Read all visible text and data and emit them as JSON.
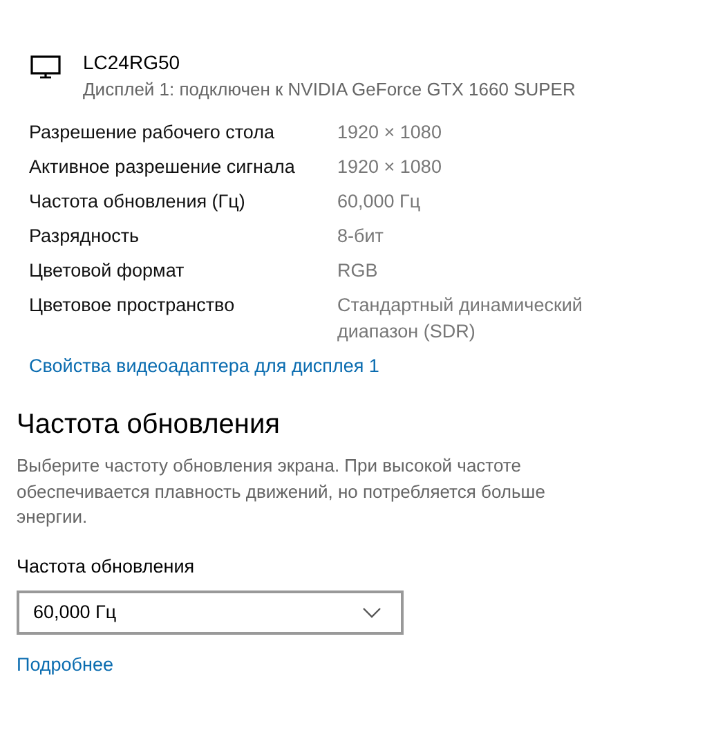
{
  "display": {
    "name": "LC24RG50",
    "subtitle": "Дисплей 1: подключен к NVIDIA GeForce GTX 1660 SUPER"
  },
  "properties": [
    {
      "label": "Разрешение рабочего стола",
      "value": "1920 × 1080"
    },
    {
      "label": "Активное разрешение сигнала",
      "value": "1920 × 1080"
    },
    {
      "label": "Частота обновления (Гц)",
      "value": "60,000 Гц"
    },
    {
      "label": "Разрядность",
      "value": "8-бит"
    },
    {
      "label": "Цветовой формат",
      "value": "RGB"
    },
    {
      "label": "Цветовое пространство",
      "value": "Стандартный динамический диапазон (SDR)"
    }
  ],
  "adapter_link": "Свойства видеоадаптера для дисплея 1",
  "refresh_section": {
    "heading": "Частота обновления",
    "description": "Выберите частоту обновления экрана. При высокой частоте обеспечивается плавность движений, но потребляется больше энергии.",
    "field_label": "Частота обновления",
    "dropdown_value": "60,000 Гц",
    "more_link": "Подробнее"
  }
}
